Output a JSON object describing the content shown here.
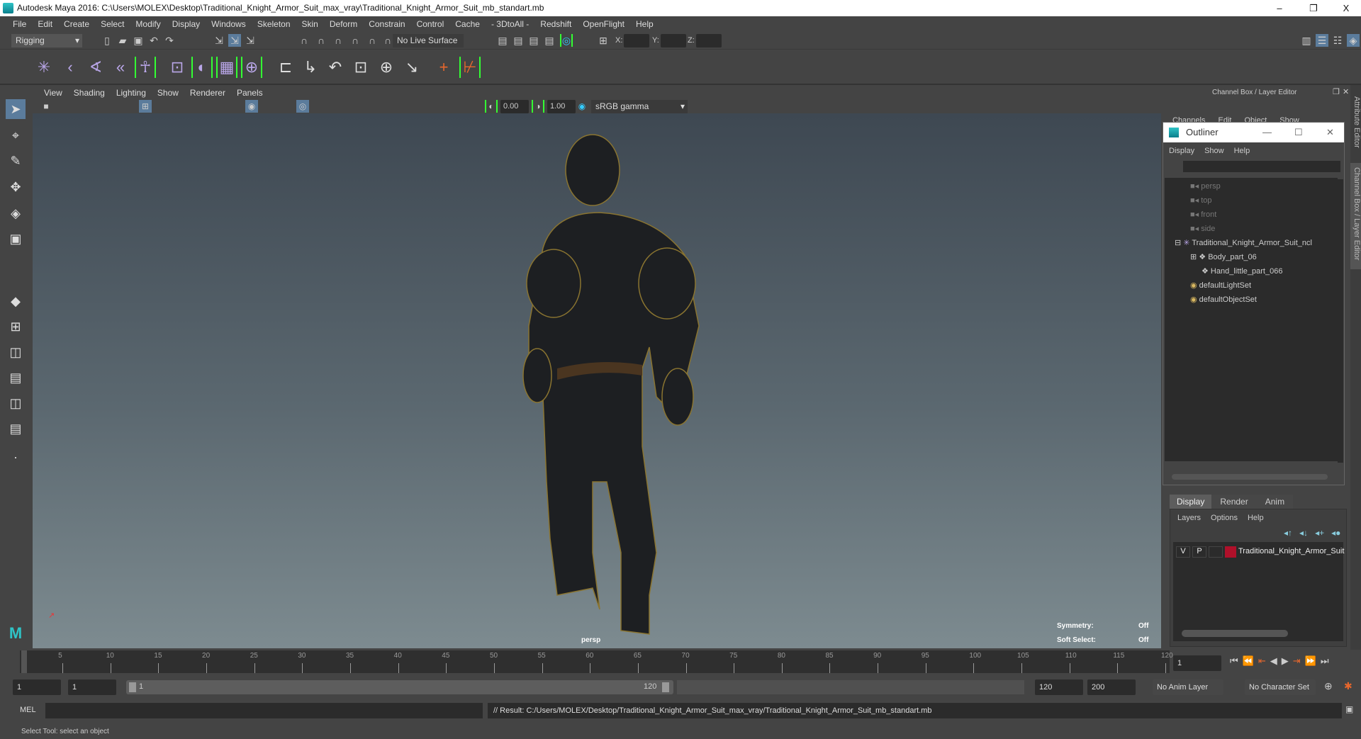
{
  "title": "Autodesk Maya 2016: C:\\Users\\MOLEX\\Desktop\\Traditional_Knight_Armor_Suit_max_vray\\Traditional_Knight_Armor_Suit_mb_standart.mb",
  "window_controls": {
    "minimize": "–",
    "restore": "❐",
    "close": "X"
  },
  "menu": [
    "File",
    "Edit",
    "Create",
    "Select",
    "Modify",
    "Display",
    "Windows",
    "Skeleton",
    "Skin",
    "Deform",
    "Constrain",
    "Control",
    "Cache",
    "- 3DtoAll -",
    "Redshift",
    "OpenFlight",
    "Help"
  ],
  "toolbar": {
    "mode": "Rigging",
    "live_surface": "No Live Surface",
    "x_label": "X:",
    "y_label": "Y:",
    "z_label": "Z:"
  },
  "viewport": {
    "menu": [
      "View",
      "Shading",
      "Lighting",
      "Show",
      "Renderer",
      "Panels"
    ],
    "exposure": "0.00",
    "gamma": "1.00",
    "color_space": "sRGB gamma",
    "camera": "persp",
    "symmetry_label": "Symmetry:",
    "symmetry_value": "Off",
    "soft_select_label": "Soft Select:",
    "soft_select_value": "Off"
  },
  "channel_box": {
    "title": "Channel Box / Layer Editor",
    "menu": [
      "Channels",
      "Edit",
      "Object",
      "Show"
    ]
  },
  "side_tabs": [
    "Attribute Editor",
    "Channel Box / Layer Editor"
  ],
  "outliner": {
    "title": "Outliner",
    "menu": [
      "Display",
      "Show",
      "Help"
    ],
    "items": [
      {
        "label": "persp",
        "type": "camera"
      },
      {
        "label": "top",
        "type": "camera"
      },
      {
        "label": "front",
        "type": "camera"
      },
      {
        "label": "side",
        "type": "camera"
      },
      {
        "label": "Traditional_Knight_Armor_Suit_ncl",
        "type": "group"
      },
      {
        "label": "Body_part_06",
        "type": "mesh"
      },
      {
        "label": "Hand_little_part_066",
        "type": "mesh"
      },
      {
        "label": "defaultLightSet",
        "type": "set"
      },
      {
        "label": "defaultObjectSet",
        "type": "set"
      }
    ]
  },
  "layer_editor": {
    "tabs": [
      "Display",
      "Render",
      "Anim"
    ],
    "menu": [
      "Layers",
      "Options",
      "Help"
    ],
    "layer": {
      "v": "V",
      "p": "P",
      "name": "Traditional_Knight_Armor_Suit",
      "color": "#b0102a"
    }
  },
  "timeline": {
    "start": 1,
    "end": 120,
    "step": 5,
    "current": "1"
  },
  "range": {
    "start": "1",
    "anim_start": "1",
    "slider_start": "1",
    "slider_end": "120",
    "end": "120",
    "anim_end": "200",
    "anim_layer": "No Anim Layer",
    "character_set": "No Character Set"
  },
  "command": {
    "label": "MEL",
    "result": "// Result: C:/Users/MOLEX/Desktop/Traditional_Knight_Armor_Suit_max_vray/Traditional_Knight_Armor_Suit_mb_standart.mb"
  },
  "status": "Select Tool: select an object"
}
